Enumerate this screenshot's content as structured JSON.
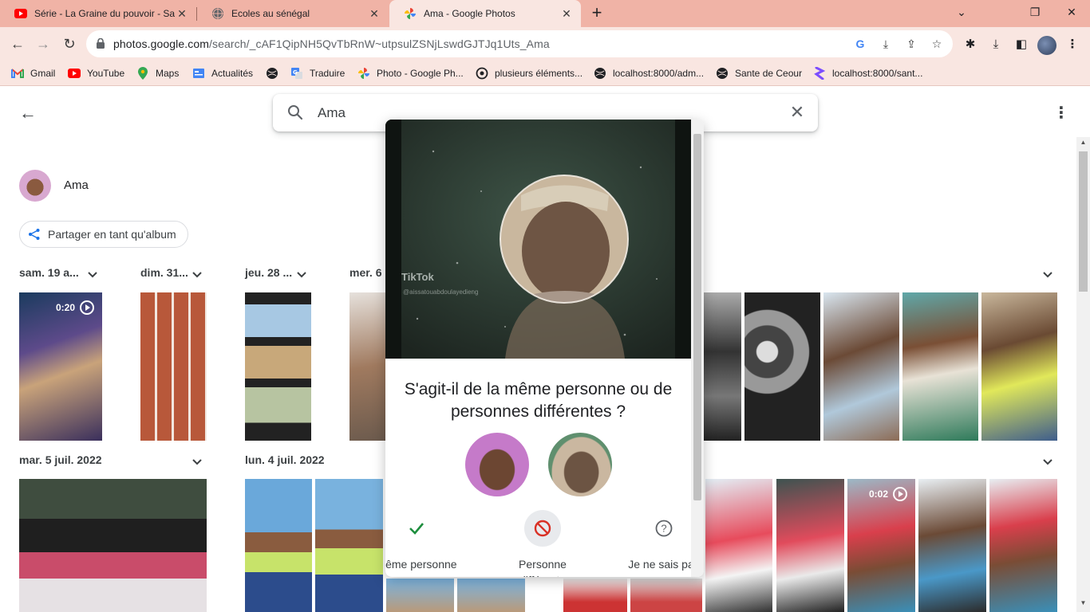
{
  "browser": {
    "tabs": [
      {
        "title": "Série - La Graine du pouvoir - Sa",
        "icon": "youtube-icon"
      },
      {
        "title": "Ecoles au sénégal",
        "icon": "globe-icon"
      },
      {
        "title": "Ama - Google Photos",
        "icon": "google-photos-icon",
        "active": true
      }
    ],
    "url_host": "photos.google.com",
    "url_path": "/search/_cAF1QipNH5QvTbRnW~utpsulZSNjLswdGJTJq1Uts_Ama",
    "bookmarks": [
      {
        "label": "Gmail",
        "icon": "gmail-icon"
      },
      {
        "label": "YouTube",
        "icon": "youtube-icon"
      },
      {
        "label": "Maps",
        "icon": "maps-icon"
      },
      {
        "label": "Actualités",
        "icon": "news-icon"
      },
      {
        "label": "",
        "icon": "globe-icon"
      },
      {
        "label": "Traduire",
        "icon": "translate-icon"
      },
      {
        "label": "Photo - Google Ph...",
        "icon": "google-photos-icon"
      },
      {
        "label": "plusieurs éléments...",
        "icon": "openai-icon"
      },
      {
        "label": "localhost:8000/adm...",
        "icon": "globe-icon"
      },
      {
        "label": "Sante de Ceour",
        "icon": "globe-icon"
      },
      {
        "label": "localhost:8000/sant...",
        "icon": "heroku-icon"
      }
    ]
  },
  "search": {
    "value": "Ama"
  },
  "person": {
    "name": "Ama"
  },
  "share_label": "Partager en tant qu'album",
  "date_groups": [
    {
      "label": "sam. 19 a..."
    },
    {
      "label": "dim. 31..."
    },
    {
      "label": "jeu. 28 ..."
    },
    {
      "label": "mer. 6 ..."
    },
    {
      "label": "mar. 5 juil. 2022"
    },
    {
      "label": "lun. 4 juil. 2022"
    }
  ],
  "video_durations": {
    "first": "0:20",
    "second": "0:02"
  },
  "dialog": {
    "watermark": "TikTok",
    "watermark_handle": "@aissatouabdoulayedieng",
    "question": "S'agit-il de la même personne ou de personnes différentes ?",
    "choices": [
      {
        "label": "Même personne",
        "icon": "check-icon"
      },
      {
        "label": "Personne différente",
        "icon": "block-icon"
      },
      {
        "label": "Je ne sais pas",
        "icon": "help-icon"
      }
    ]
  },
  "colors": {
    "tab_bar": "#f0b3a6",
    "toolbar": "#f9e6e1",
    "check": "#1e8e3e",
    "block": "#d93025"
  }
}
